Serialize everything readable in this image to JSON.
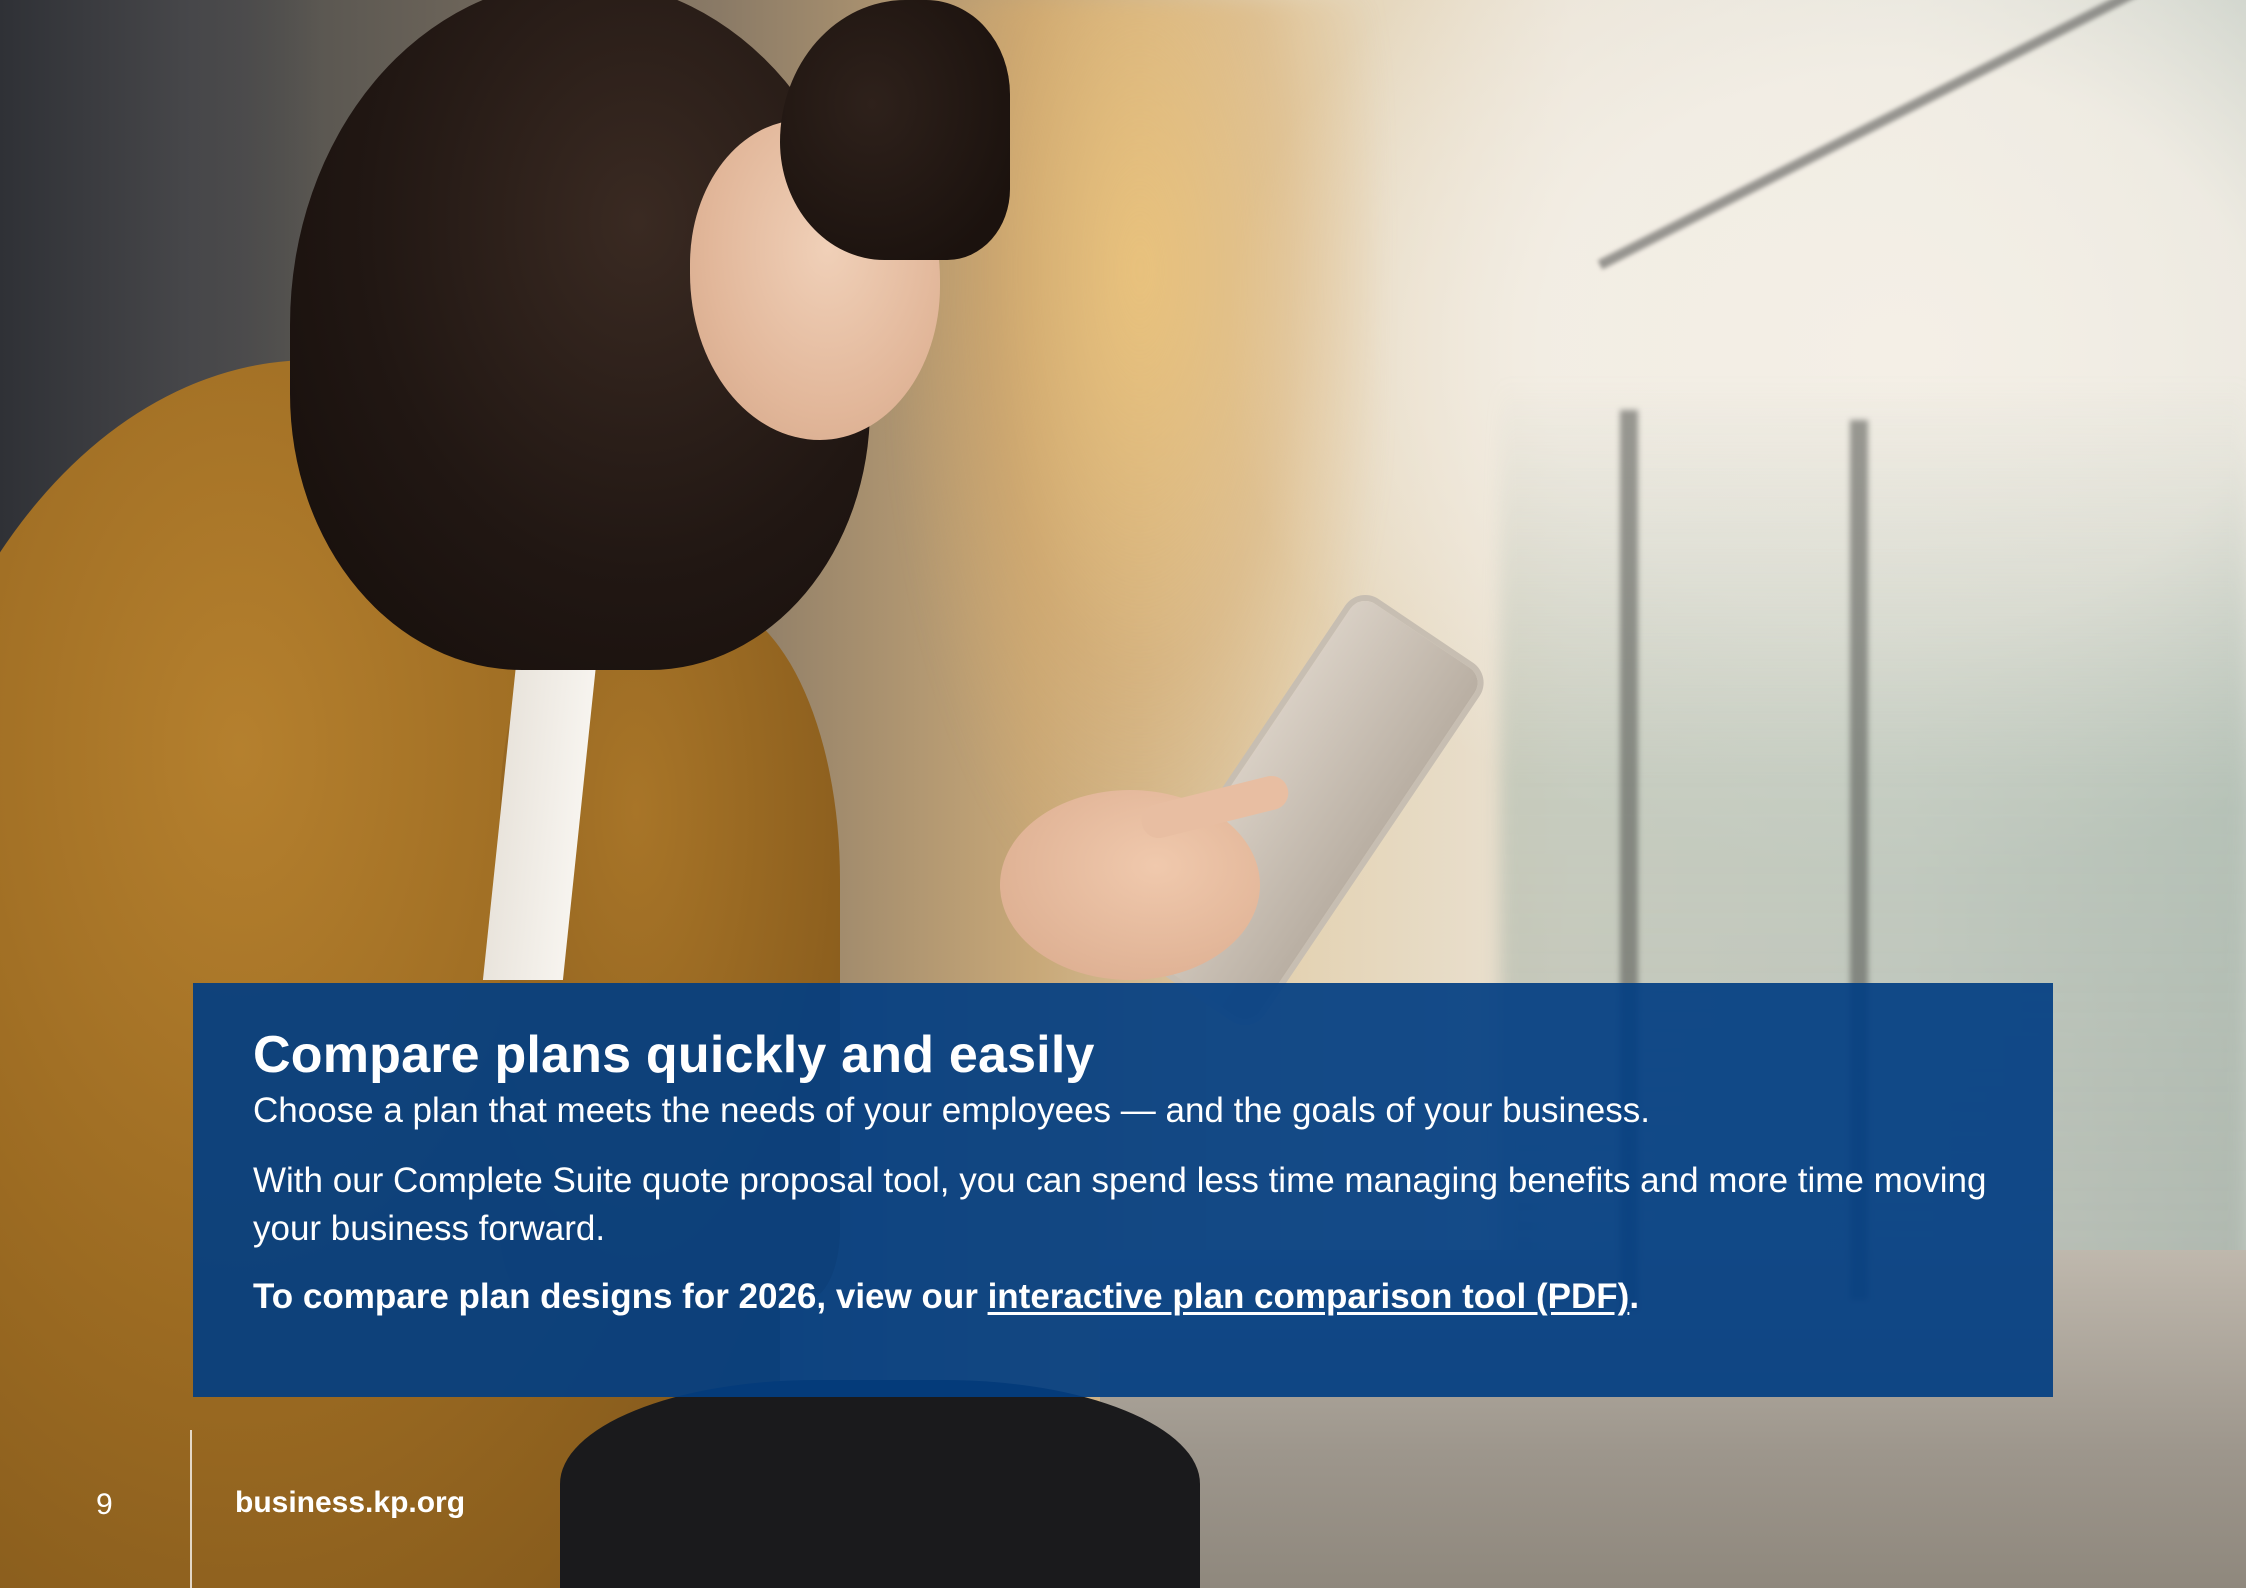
{
  "card": {
    "title": "Compare plans quickly and easily",
    "subtitle": "Choose a plan that meets the needs of your employees — and the goals of your business.",
    "body": "With our Complete Suite quote proposal tool, you can spend less time managing benefits and more time moving your business forward.",
    "cta_prefix": "To compare plan designs for 2026, view our ",
    "cta_link_text": "interactive plan comparison tool (PDF)",
    "cta_suffix": "."
  },
  "footer": {
    "page_number": "9",
    "website": "business.kp.org"
  },
  "colors": {
    "card_background": "#023E82",
    "text": "#FFFFFF"
  }
}
